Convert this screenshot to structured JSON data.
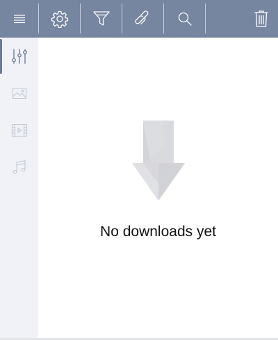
{
  "toolbar": {
    "buttons": [
      {
        "name": "menu",
        "icon": "hamburger-menu-icon"
      },
      {
        "name": "settings",
        "icon": "gear-icon"
      },
      {
        "name": "filter",
        "icon": "funnel-icon"
      },
      {
        "name": "link",
        "icon": "link-icon"
      },
      {
        "name": "search",
        "icon": "search-icon"
      },
      {
        "name": "delete",
        "icon": "trash-icon"
      }
    ],
    "background_color": "#7685a0"
  },
  "sidebar": {
    "items": [
      {
        "name": "all",
        "icon": "sliders-icon",
        "active": true
      },
      {
        "name": "images",
        "icon": "image-icon",
        "active": false
      },
      {
        "name": "video",
        "icon": "film-icon",
        "active": false
      },
      {
        "name": "music",
        "icon": "music-note-icon",
        "active": false
      }
    ],
    "background_color": "#f0f2f7"
  },
  "main": {
    "empty_state_icon": "download-arrow-icon",
    "empty_message": "No downloads yet"
  }
}
